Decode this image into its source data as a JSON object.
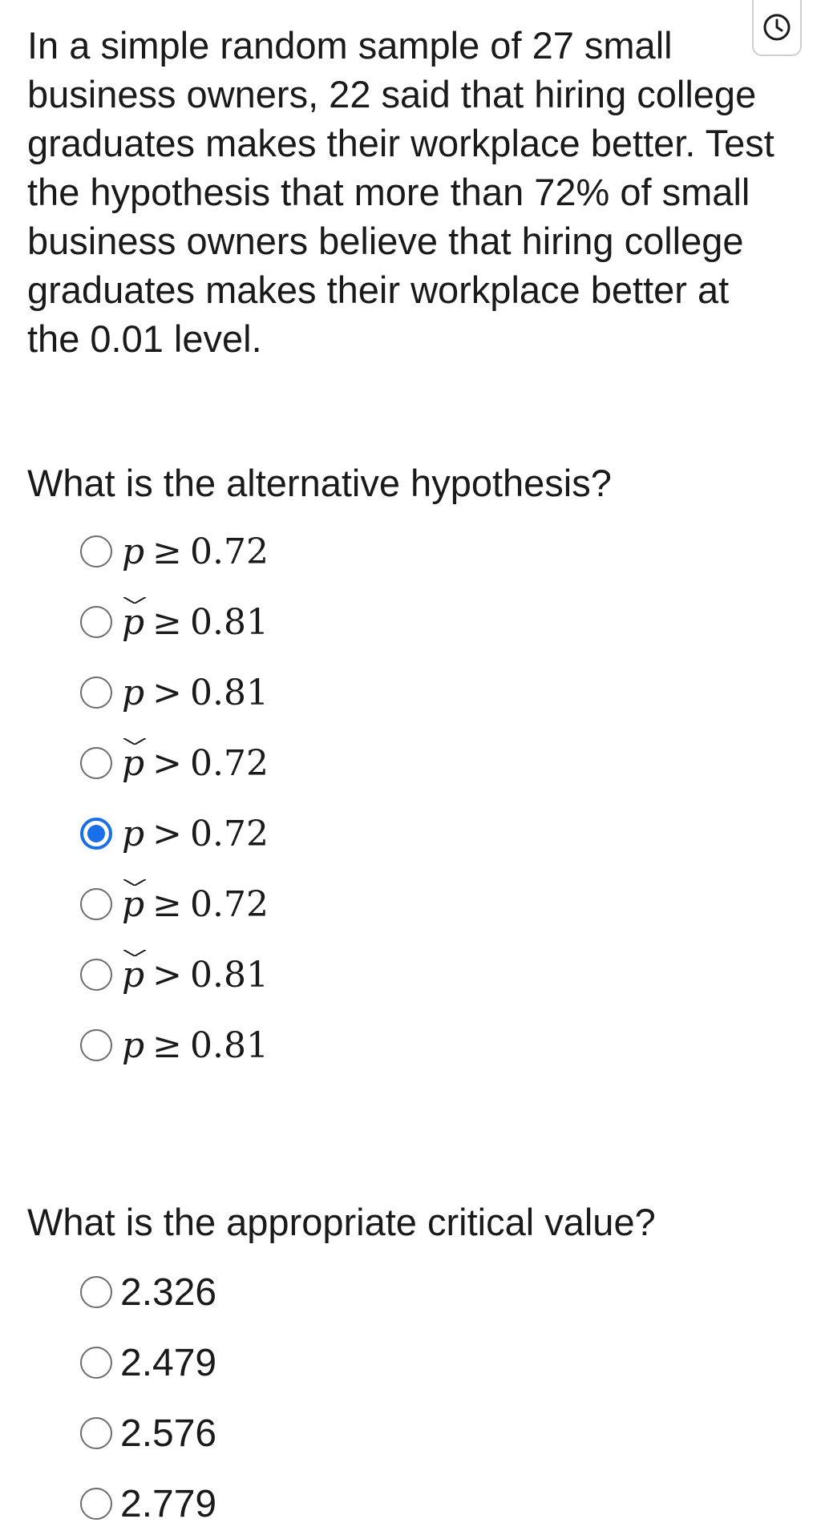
{
  "question": {
    "text": "In a simple random sample of 27 small business owners, 22 said that hiring college graduates makes their workplace better. Test the hypothesis that more than 72% of small business owners believe that hiring college graduates makes their workplace better at the 0.01 level."
  },
  "timer": {
    "icon": "clock-icon"
  },
  "part1": {
    "prompt": "What is the alternative hypothesis?",
    "selected_index": 4,
    "options": [
      {
        "variable": "p",
        "hat": false,
        "operator": "≥",
        "value": "0.72"
      },
      {
        "variable": "p",
        "hat": true,
        "operator": "≥",
        "value": "0.81"
      },
      {
        "variable": "p",
        "hat": false,
        "operator": ">",
        "value": "0.81"
      },
      {
        "variable": "p",
        "hat": true,
        "operator": ">",
        "value": "0.72"
      },
      {
        "variable": "p",
        "hat": false,
        "operator": ">",
        "value": "0.72"
      },
      {
        "variable": "p",
        "hat": true,
        "operator": "≥",
        "value": "0.72"
      },
      {
        "variable": "p",
        "hat": true,
        "operator": ">",
        "value": "0.81"
      },
      {
        "variable": "p",
        "hat": false,
        "operator": "≥",
        "value": "0.81"
      }
    ]
  },
  "part2": {
    "prompt": "What is the appropriate critical value?",
    "options": [
      "2.326",
      "2.479",
      "2.576",
      "2.779"
    ]
  },
  "colors": {
    "accent": "#1a6fe8",
    "text": "#1a1a1a",
    "radio_border": "#6d6d6d"
  }
}
